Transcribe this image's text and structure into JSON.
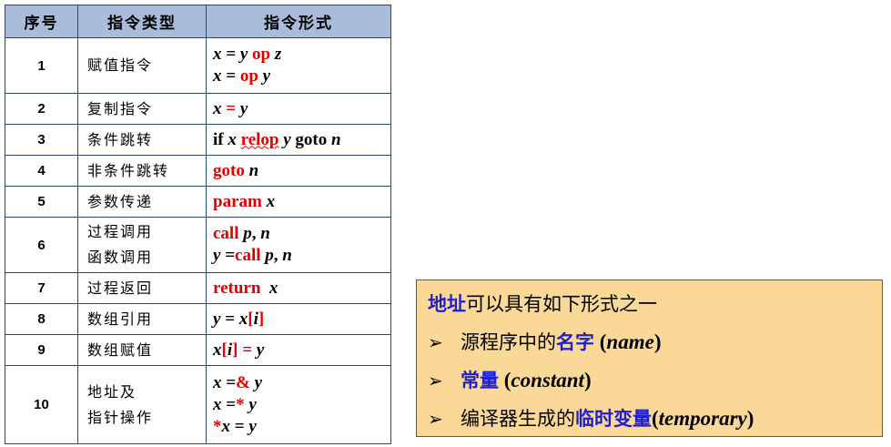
{
  "table": {
    "headers": [
      "序号",
      "指令类型",
      "指令形式"
    ],
    "rows": [
      {
        "num": "1",
        "type": [
          "赋值指令"
        ],
        "forms": [
          [
            {
              "t": "x",
              "c": "it"
            },
            {
              "t": " = ",
              "c": "bd"
            },
            {
              "t": "y",
              "c": "it"
            },
            {
              "t": " ",
              "c": ""
            },
            {
              "t": "op",
              "c": "red"
            },
            {
              "t": " ",
              "c": ""
            },
            {
              "t": "z",
              "c": "it"
            }
          ],
          [
            {
              "t": "x",
              "c": "it"
            },
            {
              "t": " = ",
              "c": "bd"
            },
            {
              "t": "op",
              "c": "red"
            },
            {
              "t": " ",
              "c": ""
            },
            {
              "t": "y",
              "c": "it"
            }
          ]
        ]
      },
      {
        "num": "2",
        "type": [
          "复制指令"
        ],
        "forms": [
          [
            {
              "t": "x",
              "c": "it"
            },
            {
              "t": " = ",
              "c": "red"
            },
            {
              "t": "y",
              "c": "it"
            }
          ]
        ]
      },
      {
        "num": "3",
        "type": [
          "条件跳转"
        ],
        "forms": [
          [
            {
              "t": "if ",
              "c": "bd"
            },
            {
              "t": "x",
              "c": "it"
            },
            {
              "t": " ",
              "c": ""
            },
            {
              "t": "relop",
              "c": "red wavy"
            },
            {
              "t": " ",
              "c": ""
            },
            {
              "t": "y",
              "c": "it"
            },
            {
              "t": " goto ",
              "c": "bd"
            },
            {
              "t": "n",
              "c": "it"
            }
          ]
        ]
      },
      {
        "num": "4",
        "type": [
          "非条件跳转"
        ],
        "forms": [
          [
            {
              "t": "goto",
              "c": "red"
            },
            {
              "t": " ",
              "c": ""
            },
            {
              "t": "n",
              "c": "it"
            }
          ]
        ]
      },
      {
        "num": "5",
        "type": [
          "参数传递"
        ],
        "forms": [
          [
            {
              "t": "param",
              "c": "red"
            },
            {
              "t": " ",
              "c": ""
            },
            {
              "t": "x",
              "c": "it"
            }
          ]
        ]
      },
      {
        "num": "6",
        "type": [
          "过程调用",
          "函数调用"
        ],
        "forms": [
          [
            {
              "t": "call",
              "c": "red"
            },
            {
              "t": " ",
              "c": ""
            },
            {
              "t": "p",
              "c": "it"
            },
            {
              "t": ", ",
              "c": "bd"
            },
            {
              "t": "n",
              "c": "it"
            }
          ],
          [
            {
              "t": "y",
              "c": "it"
            },
            {
              "t": " =",
              "c": "bd"
            },
            {
              "t": "call",
              "c": "red"
            },
            {
              "t": " ",
              "c": ""
            },
            {
              "t": "p",
              "c": "it"
            },
            {
              "t": ", ",
              "c": "bd"
            },
            {
              "t": "n",
              "c": "it"
            }
          ]
        ]
      },
      {
        "num": "7",
        "type": [
          "过程返回"
        ],
        "forms": [
          [
            {
              "t": "return",
              "c": "red"
            },
            {
              "t": "  ",
              "c": ""
            },
            {
              "t": "x",
              "c": "it"
            }
          ]
        ]
      },
      {
        "num": "8",
        "type": [
          "数组引用"
        ],
        "forms": [
          [
            {
              "t": "y",
              "c": "it"
            },
            {
              "t": " = ",
              "c": "bd"
            },
            {
              "t": "x",
              "c": "it"
            },
            {
              "t": "[",
              "c": "red"
            },
            {
              "t": "i",
              "c": "it"
            },
            {
              "t": "]",
              "c": "red"
            }
          ]
        ]
      },
      {
        "num": "9",
        "type": [
          "数组赋值"
        ],
        "forms": [
          [
            {
              "t": "x",
              "c": "it"
            },
            {
              "t": "[",
              "c": "red"
            },
            {
              "t": "i",
              "c": "it"
            },
            {
              "t": "]",
              "c": "red"
            },
            {
              "t": " = ",
              "c": "red"
            },
            {
              "t": "y",
              "c": "it"
            }
          ]
        ]
      },
      {
        "num": "10",
        "type": [
          "地址及",
          "指针操作"
        ],
        "forms": [
          [
            {
              "t": "x",
              "c": "it"
            },
            {
              "t": " =",
              "c": "bd"
            },
            {
              "t": "&",
              "c": "red"
            },
            {
              "t": " ",
              "c": ""
            },
            {
              "t": "y",
              "c": "it"
            }
          ],
          [
            {
              "t": "x",
              "c": "it"
            },
            {
              "t": " =",
              "c": "bd"
            },
            {
              "t": "*",
              "c": "red"
            },
            {
              "t": " ",
              "c": ""
            },
            {
              "t": "y",
              "c": "it"
            }
          ],
          [
            {
              "t": "*",
              "c": "red"
            },
            {
              "t": "x",
              "c": "it"
            },
            {
              "t": " = ",
              "c": "bd"
            },
            {
              "t": "y",
              "c": "it"
            }
          ]
        ]
      }
    ]
  },
  "note": {
    "title_blue": "地址",
    "title_rest": "可以具有如下形式之一",
    "arrow": "➢",
    "items": [
      {
        "pre": "源程序中的",
        "blue": "名字",
        "post": " (",
        "en": "name",
        "end": ")"
      },
      {
        "pre": "",
        "blue": "常量",
        "post": " (",
        "en": "constant",
        "end": ")"
      },
      {
        "pre": "编译器生成的",
        "blue": "临时变量",
        "post": "(",
        "en": "temporary",
        "end": ")"
      }
    ]
  },
  "colors": {
    "header_bg": "#a9bcd9",
    "box_bg": "#f9d898",
    "red": "#e00000",
    "blue": "#1f1fd0"
  }
}
